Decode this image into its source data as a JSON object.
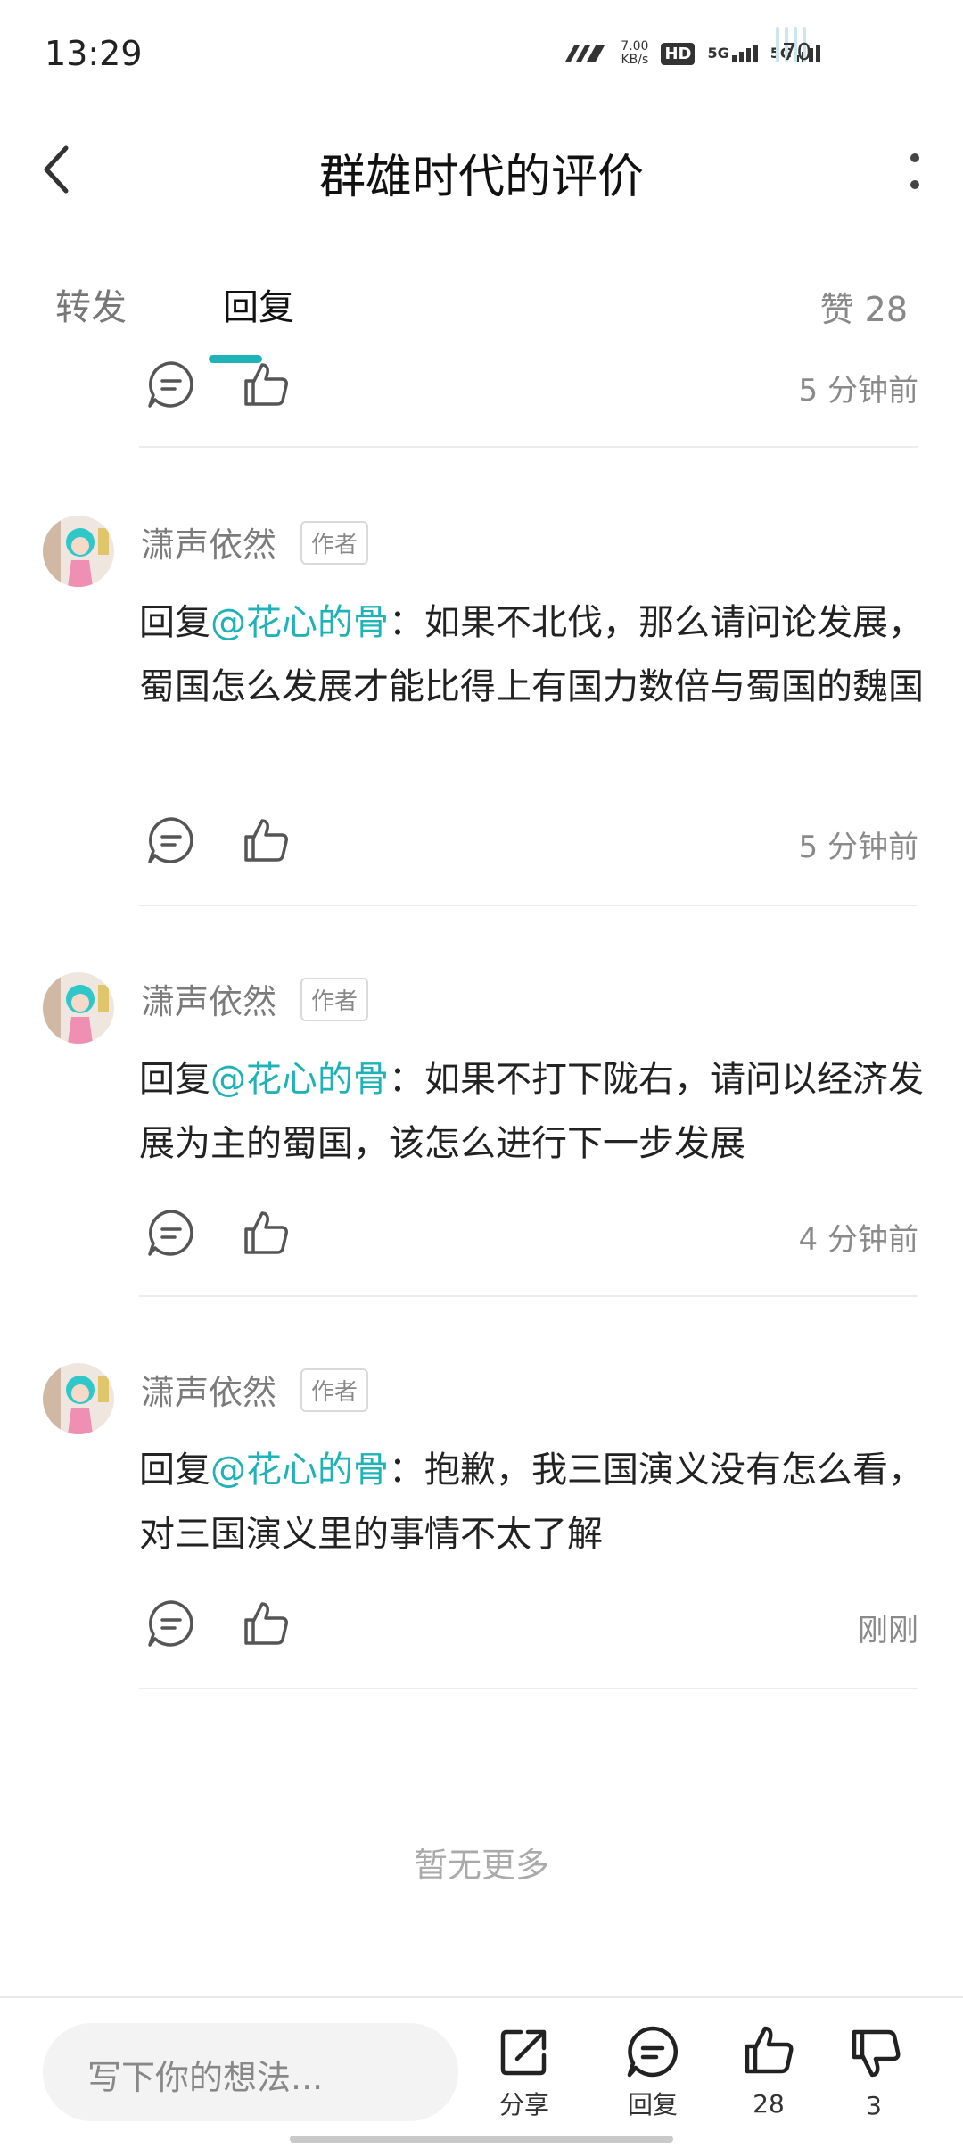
{
  "status_bar": {
    "time": "13:29",
    "net_speed_value": "7.00",
    "net_speed_unit": "KB/s",
    "hd_label": "HD",
    "sim1_label": "5G",
    "sim2_label": "5G",
    "battery": "70"
  },
  "header": {
    "title": "群雄时代的评价"
  },
  "tabs": {
    "forward": "转发",
    "reply": "回复",
    "likes": "赞 28"
  },
  "top_partial": {
    "time": "5 分钟前"
  },
  "comments": [
    {
      "name": "潇声依然",
      "badge": "作者",
      "prefix": "回复",
      "mention": "@花心的骨",
      "text": "：如果不北伐，那么请问论发展，蜀国怎么发展才能比得上有国力数倍与蜀国的魏国",
      "time": "5 分钟前"
    },
    {
      "name": "潇声依然",
      "badge": "作者",
      "prefix": "回复",
      "mention": "@花心的骨",
      "text": "：如果不打下陇右，请问以经济发展为主的蜀国，该怎么进行下一步发展",
      "time": "4 分钟前"
    },
    {
      "name": "潇声依然",
      "badge": "作者",
      "prefix": "回复",
      "mention": "@花心的骨",
      "text": "：抱歉，我三国演义没有怎么看，对三国演义里的事情不太了解",
      "time": "刚刚"
    }
  ],
  "no_more": "暂无更多",
  "bottom_bar": {
    "input_placeholder": "写下你的想法...",
    "share_label": "分享",
    "reply_label": "回复",
    "like_count": "28",
    "dislike_count": "3"
  },
  "colors": {
    "accent": "#1fb3b8",
    "icon_gray": "#555555"
  }
}
